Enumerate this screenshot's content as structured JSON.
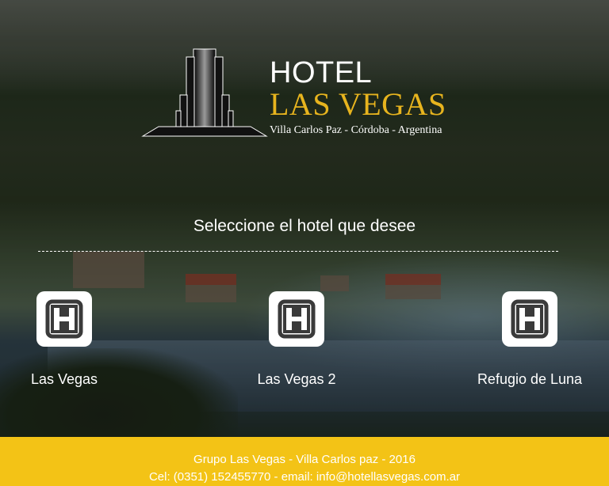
{
  "brand": {
    "hotel_word": "HOTEL",
    "name": "LAS VEGAS",
    "location": "Villa Carlos Paz - Córdoba - Argentina",
    "accent_color": "#e7b41e"
  },
  "main": {
    "prompt": "Seleccione el hotel que desee",
    "hotels": [
      {
        "label": "Las Vegas",
        "icon": "hotel-h-icon"
      },
      {
        "label": "Las Vegas 2",
        "icon": "hotel-h-icon"
      },
      {
        "label": "Refugio de Luna",
        "icon": "hotel-h-icon"
      }
    ]
  },
  "footer": {
    "line1": "Grupo Las Vegas - Villa Carlos paz - 2016",
    "line2": "Cel: (0351) 152455770 - email: info@hotellasvegas.com.ar",
    "background_color": "#f3c316"
  }
}
